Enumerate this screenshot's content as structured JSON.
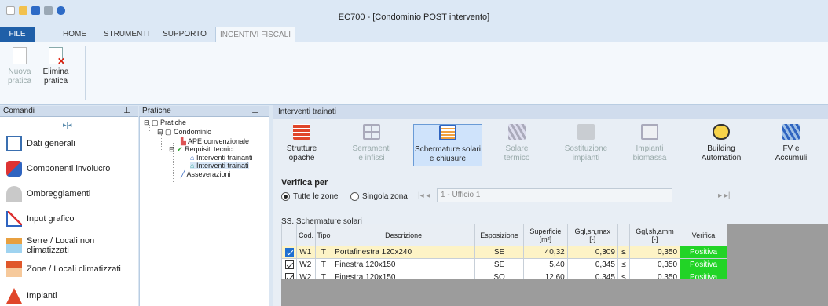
{
  "window": {
    "title": "EC700 - [Condominio POST intervento]"
  },
  "tabs": [
    "FILE",
    "HOME",
    "STRUMENTI",
    "SUPPORTO",
    "INCENTIVI FISCALI"
  ],
  "ribbon": {
    "nuova_line1": "Nuova",
    "nuova_line2": "pratica",
    "elimina_line1": "Elimina",
    "elimina_line2": "pratica"
  },
  "comandi": {
    "title": "Comandi",
    "items": [
      "Dati generali",
      "Componenti involucro",
      "Ombreggiamenti",
      "Input grafico",
      "Serre / Locali non climatizzati",
      "Zone / Locali climatizzati",
      "Impianti"
    ]
  },
  "pratiche": {
    "title": "Pratiche",
    "nodes": [
      "Pratiche",
      "Condominio",
      "APE convenzionale",
      "Requisiti tecnici",
      "Interventi trainanti",
      "Interventi trainati",
      "Asseverazioni"
    ]
  },
  "main": {
    "header": "Interventi trainati",
    "buttons": [
      {
        "l1": "Strutture",
        "l2": "opache"
      },
      {
        "l1": "Serramenti",
        "l2": "e infissi"
      },
      {
        "l1": "Schermature solari",
        "l2": "e chiusure"
      },
      {
        "l1": "Solare",
        "l2": "termico"
      },
      {
        "l1": "Sostituzione",
        "l2": "impianti"
      },
      {
        "l1": "Impianti",
        "l2": "biomassa"
      },
      {
        "l1": "Building",
        "l2": "Automation"
      },
      {
        "l1": "FV e",
        "l2": "Accumuli"
      }
    ],
    "verifica_title": "Verifica per",
    "radio_all": "Tutte le zone",
    "radio_single": "Singola zona",
    "zone_value": "1 - Ufficio 1",
    "section_label": "SS. Schermature solari"
  },
  "table": {
    "headers": {
      "cod": "Cod.",
      "tipo": "Tipo",
      "descr": "Descrizione",
      "espo": "Esposizione",
      "sup1": "Superficie",
      "sup2": "[m²]",
      "gglmax1": "Ggl,sh,max",
      "gglmax2": "[-]",
      "gglamm1": "Ggl,sh,amm",
      "gglamm2": "[-]",
      "verifica": "Verifica"
    },
    "rows": [
      {
        "cod": "W1",
        "tipo": "T",
        "descr": "Portafinestra 120x240",
        "espo": "SE",
        "sup": "40,32",
        "gmax": "0,309",
        "cmp": "≤",
        "gamm": "0,350",
        "ver": "Positiva"
      },
      {
        "cod": "W2",
        "tipo": "T",
        "descr": "Finestra 120x150",
        "espo": "SE",
        "sup": "5,40",
        "gmax": "0,345",
        "cmp": "≤",
        "gamm": "0,350",
        "ver": "Positiva"
      },
      {
        "cod": "W2",
        "tipo": "T",
        "descr": "Finestra 120x150",
        "espo": "SO",
        "sup": "12,60",
        "gmax": "0,345",
        "cmp": "≤",
        "gamm": "0,350",
        "ver": "Positiva"
      }
    ]
  }
}
